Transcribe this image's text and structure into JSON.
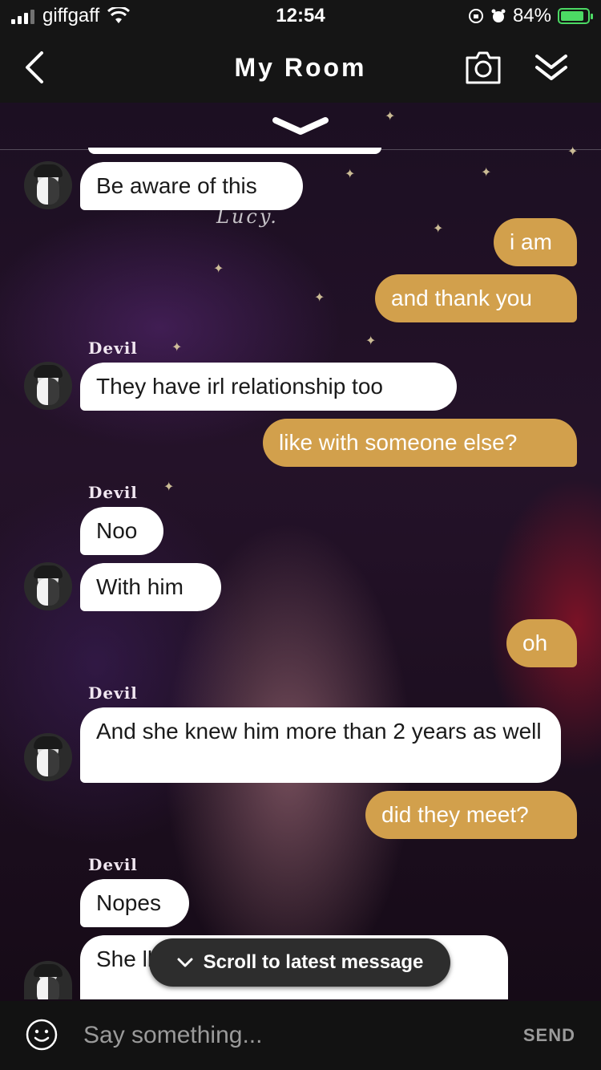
{
  "status_bar": {
    "carrier": "giffgaff",
    "time": "12:54",
    "battery_percent": "84%",
    "battery_color": "#4cd964"
  },
  "nav": {
    "title": "My Room",
    "back_icon": "chevron-left-icon",
    "camera_icon": "camera-icon",
    "collapse_icon": "double-chevron-down-icon"
  },
  "watermark": "Lucy.",
  "messages": [
    {
      "side": "in",
      "text": "Be aware of this"
    },
    {
      "side": "out",
      "text": "i am"
    },
    {
      "side": "out",
      "text": "and thank you"
    },
    {
      "side": "sender",
      "text": "Devil"
    },
    {
      "side": "in",
      "text": "They have irl relationship too"
    },
    {
      "side": "out",
      "text": "like with someone else?"
    },
    {
      "side": "sender",
      "text": "Devil"
    },
    {
      "side": "in",
      "text": "Noo"
    },
    {
      "side": "in",
      "text": "With him"
    },
    {
      "side": "out",
      "text": "oh"
    },
    {
      "side": "sender",
      "text": "Devil"
    },
    {
      "side": "in",
      "text": "And she knew him more than 2 years as well"
    },
    {
      "side": "out",
      "text": "did they meet?"
    },
    {
      "side": "sender",
      "text": "Devil"
    },
    {
      "side": "in",
      "text": "Nopes"
    },
    {
      "side": "in",
      "text": "She ll 6 months of relationship"
    }
  ],
  "scroll_button": "Scroll to latest message",
  "composer": {
    "placeholder": "Say something...",
    "send_label": "SEND"
  },
  "colors": {
    "outgoing_bubble": "#d2a04c",
    "incoming_bubble": "#ffffff",
    "bar_background": "#151515"
  }
}
